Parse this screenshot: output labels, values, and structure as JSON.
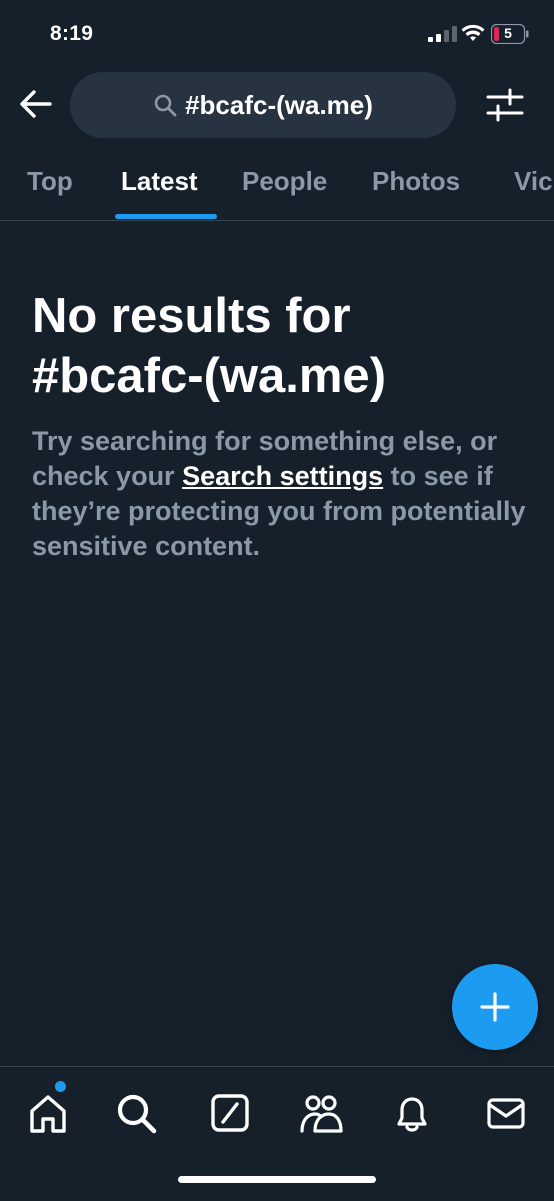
{
  "status_bar": {
    "time": "8:19",
    "battery_level": "5"
  },
  "search": {
    "query": "#bcafc-(wa.me)"
  },
  "tabs": [
    {
      "label": "Top",
      "active": false
    },
    {
      "label": "Latest",
      "active": true
    },
    {
      "label": "People",
      "active": false
    },
    {
      "label": "Photos",
      "active": false
    },
    {
      "label": "Vic",
      "active": false
    }
  ],
  "empty_state": {
    "title_line1": "No results for",
    "title_line2": "#bcafc-(wa.me)",
    "body_before": "Try searching for something else, or check your ",
    "body_link": "Search settings",
    "body_after": " to see if they’re protecting you from potentially sensitive content."
  },
  "bottom_nav": {
    "items": [
      {
        "icon": "home-icon",
        "has_notification_dot": true
      },
      {
        "icon": "search-icon"
      },
      {
        "icon": "grok-icon"
      },
      {
        "icon": "communities-icon"
      },
      {
        "icon": "bell-icon"
      },
      {
        "icon": "mail-icon"
      }
    ]
  },
  "colors": {
    "background": "#15202b",
    "accent": "#1d9bf0",
    "secondary_text": "#8b98a5",
    "search_bg": "#273340",
    "divider": "#38444d"
  }
}
